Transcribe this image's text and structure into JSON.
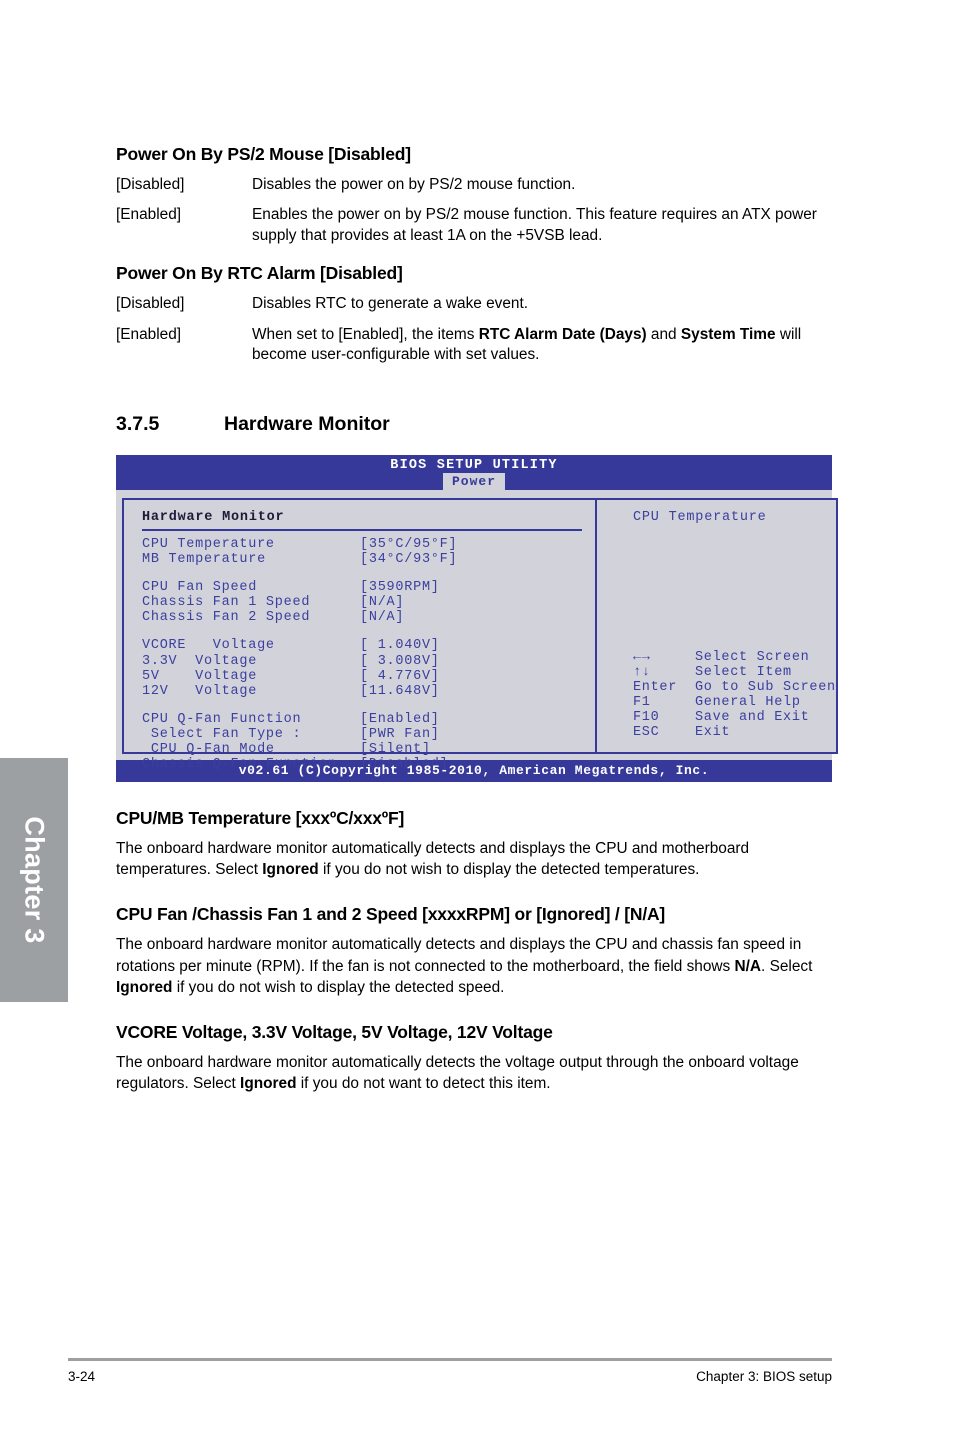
{
  "chapter_tab": {
    "label": "Chapter 3"
  },
  "sections": [
    {
      "heading": "Power On By PS/2 Mouse [Disabled]",
      "options": [
        {
          "key": "[Disabled]",
          "desc": "Disables the power on by PS/2 mouse function."
        },
        {
          "key": "[Enabled]",
          "desc": "Enables the power on by PS/2 mouse function. This feature requires an ATX power supply that provides at least 1A on the +5VSB lead."
        }
      ]
    },
    {
      "heading": "Power On By RTC Alarm [Disabled]",
      "options": [
        {
          "key": "[Disabled]",
          "desc": "Disables RTC to generate a wake event."
        },
        {
          "key": "[Enabled]",
          "desc": "When set to [Enabled], the items RTC Alarm Date (Days) and System Time will become user-configurable with set values."
        }
      ]
    }
  ],
  "section_heading": {
    "number": "3.7.5",
    "title": "Hardware Monitor"
  },
  "bios": {
    "title": "BIOS SETUP UTILITY",
    "active_tab": "Power",
    "panel_title": "Hardware Monitor",
    "items": [
      {
        "label": "CPU Temperature",
        "value": "[35°C/95°F]"
      },
      {
        "label": "MB Temperature",
        "value": "[34°C/93°F]"
      },
      {
        "label": "",
        "value": ""
      },
      {
        "label": "CPU Fan Speed",
        "value": "[3590RPM]"
      },
      {
        "label": "Chassis Fan 1 Speed",
        "value": "[N/A]"
      },
      {
        "label": "Chassis Fan 2 Speed",
        "value": "[N/A]"
      },
      {
        "label": "",
        "value": ""
      },
      {
        "label": "VCORE   Voltage",
        "value": "[ 1.040V]"
      },
      {
        "label": "3.3V  Voltage",
        "value": "[ 3.008V]"
      },
      {
        "label": "5V    Voltage",
        "value": "[ 4.776V]"
      },
      {
        "label": "12V   Voltage",
        "value": "[11.648V]"
      },
      {
        "label": "",
        "value": ""
      },
      {
        "label": "CPU Q-Fan Function",
        "value": "[Enabled]"
      },
      {
        "label": " Select Fan Type :",
        "value": "[PWR Fan]"
      },
      {
        "label": " CPU Q-Fan Mode",
        "value": "[Silent]"
      },
      {
        "label": "Chassis Q-Fan Function",
        "value": "[Disabled]"
      }
    ],
    "help_title": "CPU Temperature",
    "nav": [
      {
        "key": "←→",
        "action": "Select Screen"
      },
      {
        "key": "↑↓",
        "action": "Select Item"
      },
      {
        "key": "Enter",
        "action": "Go to Sub Screen"
      },
      {
        "key": "F1",
        "action": "General Help"
      },
      {
        "key": "F10",
        "action": "Save and Exit"
      },
      {
        "key": "ESC",
        "action": "Exit"
      }
    ],
    "footer": "v02.61 (C)Copyright 1985-2010, American Megatrends, Inc.",
    "colors": {
      "chrome": "#36389a",
      "body": "#d2d2da",
      "text": "#3b3f9e"
    }
  },
  "descriptions": [
    {
      "heading": "CPU/MB Temperature [xxxºC/xxxºF]",
      "body_pre": "The onboard hardware monitor automatically detects and displays the CPU and motherboard temperatures. Select ",
      "body_bold": "Ignored",
      "body_post": " if you do not wish to display the detected temperatures."
    },
    {
      "heading": "CPU Fan /Chassis Fan 1 and 2 Speed [xxxxRPM] or [Ignored] / [N/A]",
      "body_pre": "The onboard hardware monitor automatically detects and displays the CPU and chassis fan speed in rotations per minute (RPM). If the fan is not connected to the motherboard, the field shows ",
      "body_bold": "N/A",
      "body_mid": ". Select ",
      "body_bold2": "Ignored",
      "body_post": " if you do not wish to display the detected speed."
    },
    {
      "heading": "VCORE Voltage, 3.3V Voltage, 5V Voltage, 12V Voltage",
      "body_pre": "The onboard hardware monitor automatically detects the voltage output through the onboard voltage regulators. Select ",
      "body_bold": "Ignored",
      "body_post": " if you do not want to detect this item."
    }
  ],
  "page_footer": {
    "page_number": "3-24",
    "chapter_label": "Chapter 3: BIOS setup"
  }
}
